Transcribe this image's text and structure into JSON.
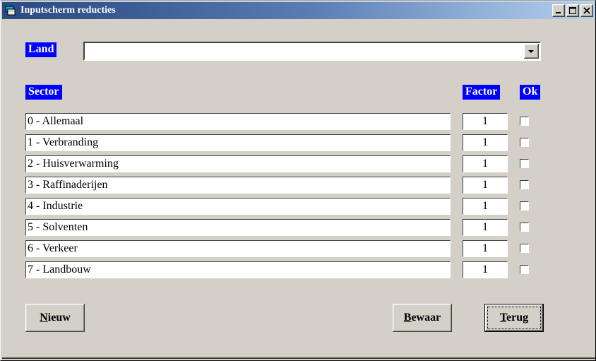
{
  "window": {
    "title": "Inputscherm reducties",
    "icon": "form-window-icon",
    "caption_buttons": [
      {
        "name": "minimize",
        "glyph": "_"
      },
      {
        "name": "maximize",
        "glyph": "□"
      },
      {
        "name": "close",
        "glyph": "✕"
      }
    ],
    "colors": {
      "title_gradient_start": "#2c4a80",
      "title_gradient_end": "#b6d0ec",
      "face": "#d4d0c8",
      "label_blue": "#0000ff",
      "label_text": "#ffffff"
    }
  },
  "form": {
    "land_label": "Land",
    "land_value": "",
    "land_placeholder": "",
    "headers": {
      "sector": "Sector",
      "factor": "Factor",
      "ok": "Ok"
    },
    "rows": [
      {
        "sector": "0 - Allemaal",
        "factor": "1",
        "checked": false
      },
      {
        "sector": "1 - Verbranding",
        "factor": "1",
        "checked": false
      },
      {
        "sector": "2 - Huisverwarming",
        "factor": "1",
        "checked": false
      },
      {
        "sector": "3 - Raffinaderijen",
        "factor": "1",
        "checked": false
      },
      {
        "sector": "4 - Industrie",
        "factor": "1",
        "checked": false
      },
      {
        "sector": "5 - Solventen",
        "factor": "1",
        "checked": false
      },
      {
        "sector": "6 - Verkeer",
        "factor": "1",
        "checked": false
      },
      {
        "sector": "7 - Landbouw",
        "factor": "1",
        "checked": false
      }
    ],
    "buttons": {
      "nieuw": {
        "label": "Nieuw",
        "accesskey": "N",
        "default": false
      },
      "bewaar": {
        "label": "Bewaar",
        "accesskey": "B",
        "default": false
      },
      "terug": {
        "label": "Terug",
        "accesskey": "T",
        "default": true
      }
    }
  }
}
